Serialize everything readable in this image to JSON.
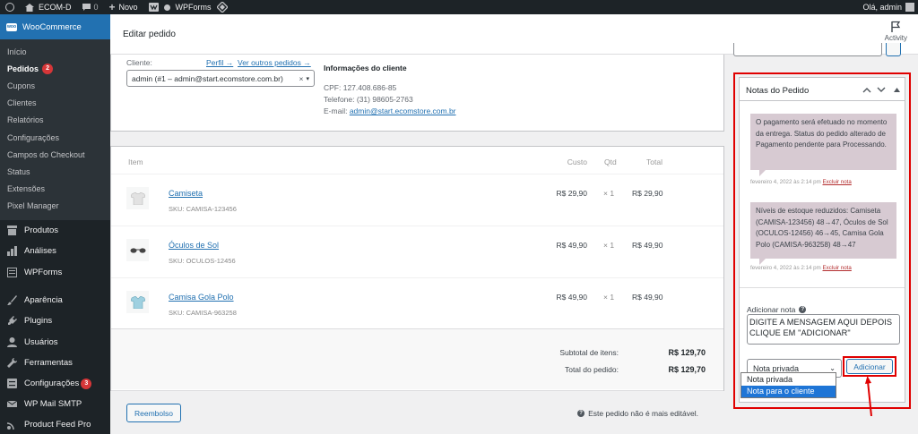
{
  "adminbar": {
    "site": "ECOM-D",
    "comments": "0",
    "new": "Novo",
    "wpforms": "WPForms",
    "greeting": "Olá, admin"
  },
  "sidebar": {
    "woocommerce": "WooCommerce",
    "woo_badge": "woo",
    "submenu": [
      {
        "label": "Início"
      },
      {
        "label": "Pedidos",
        "badge": "2"
      },
      {
        "label": "Cupons"
      },
      {
        "label": "Clientes"
      },
      {
        "label": "Relatórios"
      },
      {
        "label": "Configurações"
      },
      {
        "label": "Campos do Checkout"
      },
      {
        "label": "Status"
      },
      {
        "label": "Extensões"
      },
      {
        "label": "Pixel Manager"
      }
    ],
    "menu": [
      {
        "label": "Produtos",
        "icon": "archive-icon"
      },
      {
        "label": "Análises",
        "icon": "bar-chart-icon"
      },
      {
        "label": "WPForms",
        "icon": "form-icon"
      },
      {
        "label": "Aparência",
        "icon": "brush-icon"
      },
      {
        "label": "Plugins",
        "icon": "plug-icon"
      },
      {
        "label": "Usuários",
        "icon": "user-icon"
      },
      {
        "label": "Ferramentas",
        "icon": "wrench-icon"
      },
      {
        "label": "Configurações",
        "icon": "settings-icon",
        "badge": "3"
      },
      {
        "label": "WP Mail SMTP",
        "icon": "mail-icon"
      },
      {
        "label": "Product Feed Pro",
        "icon": "feed-icon"
      }
    ]
  },
  "header": {
    "title": "Editar pedido",
    "activity": "Activity"
  },
  "customer": {
    "label": "Cliente:",
    "profile_link": "Perfil →",
    "other_orders_link": "Ver outros pedidos →",
    "selected": "admin (#1 – admin@start.ecomstore.com.br)",
    "info_title": "Informações do cliente",
    "cpf": "CPF: 127.408.686-85",
    "phone": "Telefone: (31) 98605-2763",
    "email_label": "E-mail: ",
    "email": "admin@start.ecomstore.com.br"
  },
  "items": {
    "headers": {
      "item": "Item",
      "cost": "Custo",
      "qty": "Qtd",
      "total": "Total"
    },
    "rows": [
      {
        "name": "Camiseta",
        "sku": "SKU: CAMISA-123456",
        "cost": "R$ 29,90",
        "qty": "× 1",
        "total": "R$ 29,90",
        "thumb": "tshirt-icon"
      },
      {
        "name": "Óculos de Sol",
        "sku": "SKU: OCULOS-12456",
        "cost": "R$ 49,90",
        "qty": "× 1",
        "total": "R$ 49,90",
        "thumb": "sunglasses-icon"
      },
      {
        "name": "Camisa Gola Polo",
        "sku": "SKU: CAMISA-963258",
        "cost": "R$ 49,90",
        "qty": "× 1",
        "total": "R$ 49,90",
        "thumb": "polo-shirt-icon"
      }
    ],
    "subtotal_label": "Subtotal de itens:",
    "subtotal_value": "R$ 129,70",
    "total_label": "Total do pedido:",
    "total_value": "R$ 129,70",
    "refund_button": "Reembolso",
    "not_editable": "Este pedido não é mais editável."
  },
  "notes": {
    "title": "Notas do Pedido",
    "list": [
      {
        "text": "O pagamento será efetuado no momento da entrega. Status do pedido alterado de Pagamento pendente para Processando.",
        "date": "fevereiro 4, 2022 às 2:14 pm",
        "delete": "Excluir nota"
      },
      {
        "text": "Níveis de estoque reduzidos: Camiseta (CAMISA-123456) 48→47, Óculos de Sol (OCULOS-12456) 46→45, Camisa Gola Polo (CAMISA-963258) 48→47",
        "date": "fevereiro 4, 2022 às 2:14 pm",
        "delete": "Excluir nota"
      }
    ],
    "add_label": "Adicionar nota",
    "help": "?",
    "textarea_value": "DIGITE A MENSAGEM AQUI DEPOIS CLIQUE EM \"ADICIONAR\"",
    "type_selected": "Nota privada",
    "type_options": [
      "Nota privada",
      "Nota para o cliente"
    ],
    "add_button": "Adicionar"
  },
  "colors": {
    "admin_dark": "#1d2327",
    "accent": "#2271b1",
    "highlight_red": "#e00000",
    "note_bg": "#d7cad2"
  }
}
